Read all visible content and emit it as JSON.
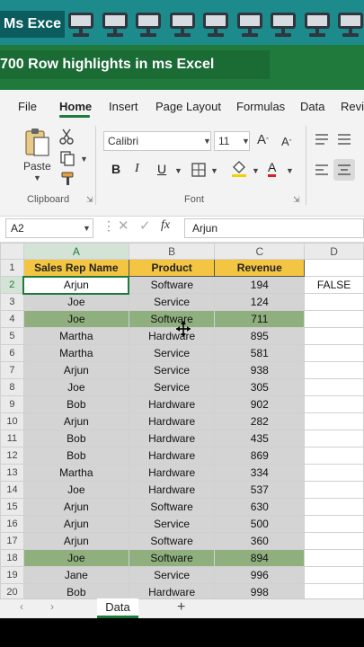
{
  "overlay": {
    "channel_label": "Ms Exce",
    "video_title": "700 Row highlights in ms Excel",
    "icon_count": 9
  },
  "menu": {
    "tabs": [
      "File",
      "Home",
      "Insert",
      "Page Layout",
      "Formulas",
      "Data",
      "Revi"
    ],
    "active": "Home"
  },
  "ribbon": {
    "paste_label": "Paste",
    "clipboard_label": "Clipboard",
    "font_label": "Font",
    "font_name": "Calibri",
    "font_size": "11",
    "bold": "B",
    "italic": "I",
    "underline": "U"
  },
  "formula_bar": {
    "name_box": "A2",
    "fx": "fx",
    "value": "Arjun"
  },
  "sheet": {
    "columns": [
      "A",
      "B",
      "C",
      "D"
    ],
    "headers": [
      "Sales Rep Name",
      "Product",
      "Revenue"
    ],
    "d2_value": "FALSE",
    "rows": [
      {
        "n": "2",
        "rep": "Arjun",
        "product": "Software",
        "revenue": "194",
        "hl": false
      },
      {
        "n": "3",
        "rep": "Joe",
        "product": "Service",
        "revenue": "124",
        "hl": false
      },
      {
        "n": "4",
        "rep": "Joe",
        "product": "Software",
        "revenue": "711",
        "hl": true
      },
      {
        "n": "5",
        "rep": "Martha",
        "product": "Hardware",
        "revenue": "895",
        "hl": false
      },
      {
        "n": "6",
        "rep": "Martha",
        "product": "Service",
        "revenue": "581",
        "hl": false
      },
      {
        "n": "7",
        "rep": "Arjun",
        "product": "Service",
        "revenue": "938",
        "hl": false
      },
      {
        "n": "8",
        "rep": "Joe",
        "product": "Service",
        "revenue": "305",
        "hl": false
      },
      {
        "n": "9",
        "rep": "Bob",
        "product": "Hardware",
        "revenue": "902",
        "hl": false
      },
      {
        "n": "10",
        "rep": "Arjun",
        "product": "Hardware",
        "revenue": "282",
        "hl": false
      },
      {
        "n": "11",
        "rep": "Bob",
        "product": "Hardware",
        "revenue": "435",
        "hl": false
      },
      {
        "n": "12",
        "rep": "Bob",
        "product": "Hardware",
        "revenue": "869",
        "hl": false
      },
      {
        "n": "13",
        "rep": "Martha",
        "product": "Hardware",
        "revenue": "334",
        "hl": false
      },
      {
        "n": "14",
        "rep": "Joe",
        "product": "Hardware",
        "revenue": "537",
        "hl": false
      },
      {
        "n": "15",
        "rep": "Arjun",
        "product": "Software",
        "revenue": "630",
        "hl": false
      },
      {
        "n": "16",
        "rep": "Arjun",
        "product": "Service",
        "revenue": "500",
        "hl": false
      },
      {
        "n": "17",
        "rep": "Arjun",
        "product": "Software",
        "revenue": "360",
        "hl": false
      },
      {
        "n": "18",
        "rep": "Joe",
        "product": "Software",
        "revenue": "894",
        "hl": true
      },
      {
        "n": "19",
        "rep": "Jane",
        "product": "Service",
        "revenue": "996",
        "hl": false
      },
      {
        "n": "20",
        "rep": "Bob",
        "product": "Hardware",
        "revenue": "998",
        "hl": false
      }
    ],
    "sheet_tab": "Data",
    "add_sheet": "+"
  },
  "colors": {
    "excel_green": "#1f7a3c",
    "highlight_row": "#8fb07e",
    "header_fill": "#f4c542",
    "data_fill": "#d4d4d4",
    "banner_teal": "#1d8a8c"
  }
}
